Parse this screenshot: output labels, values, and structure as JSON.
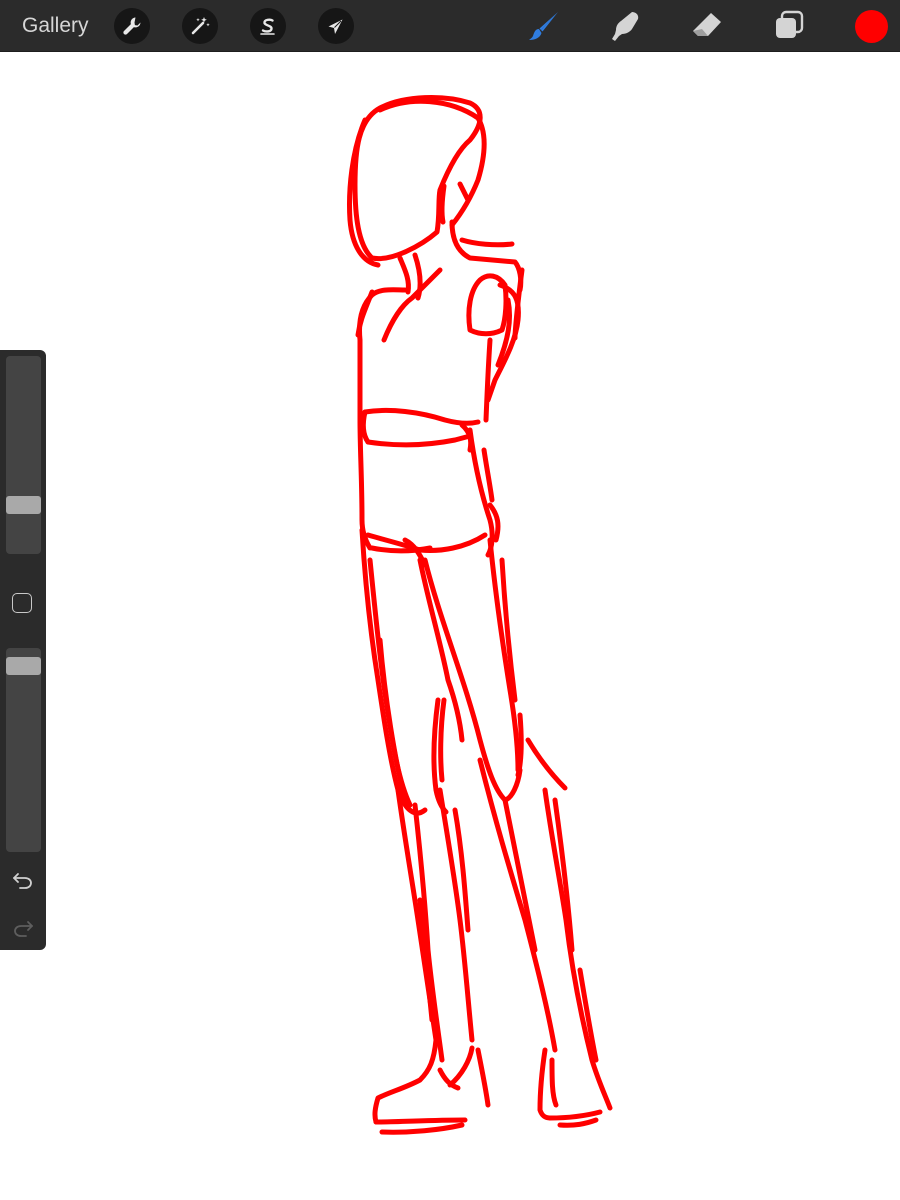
{
  "toolbar": {
    "gallery_label": "Gallery",
    "left_tools": [
      {
        "name": "actions",
        "icon": "wrench-icon"
      },
      {
        "name": "adjustments",
        "icon": "magic-wand-icon"
      },
      {
        "name": "selection",
        "icon": "selection-s-icon"
      },
      {
        "name": "transform",
        "icon": "arrow-cursor-icon"
      }
    ],
    "right_tools": [
      {
        "name": "brush",
        "icon": "brush-icon",
        "active": true
      },
      {
        "name": "smudge",
        "icon": "smudge-finger-icon",
        "active": false
      },
      {
        "name": "eraser",
        "icon": "eraser-icon",
        "active": false
      },
      {
        "name": "layers",
        "icon": "layers-icon",
        "active": false
      }
    ],
    "current_color": "#ff0000"
  },
  "sidebar": {
    "brush_size_level": 0.22,
    "brush_opacity_level": 0.95,
    "modify_icon": "square-outline-icon",
    "undo_icon": "undo-icon",
    "redo_icon": "redo-icon",
    "redo_enabled": false
  },
  "colors": {
    "toolbar_bg": "#2b2b2b",
    "active_tool": "#2f7de1",
    "inactive_tool": "#d4d4d4",
    "stroke": "#ff0000",
    "canvas": "#ffffff"
  }
}
